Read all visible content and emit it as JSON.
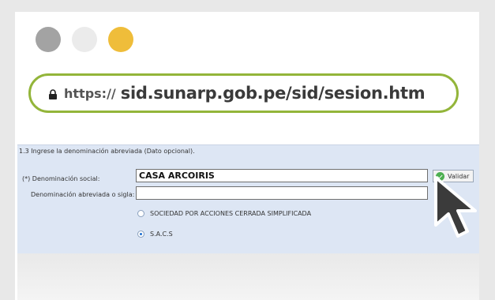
{
  "browser": {
    "url_scheme": "https://",
    "url_host": "sid.sunarp.gob.pe/sid/sesion.htm",
    "icons": [
      "lock-icon",
      "mouse-cursor-icon"
    ],
    "accent_color": "#93b53a"
  },
  "form": {
    "section_title": "1.3 Ingrese la denominación abreviada (Dato opcional).",
    "denominacion_label": "(*) Denominación social:",
    "denominacion_value": "CASA ARCOIRIS",
    "abreviada_label": "Denominación abreviada o sigla:",
    "abreviada_value": "",
    "validar_label": "Validar",
    "options": [
      {
        "label": "SOCIEDAD POR ACCIONES CERRADA SIMPLIFICADA",
        "selected": false
      },
      {
        "label": "S.A.C.S",
        "selected": true
      }
    ]
  }
}
